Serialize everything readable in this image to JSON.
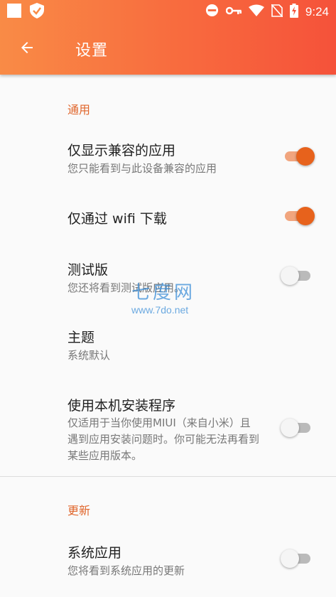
{
  "status_bar": {
    "time": "9:24",
    "icons": [
      "square-icon",
      "shield-check-icon",
      "do-not-disturb-icon",
      "key-icon",
      "wifi-icon",
      "no-sim-icon",
      "battery-charging-icon"
    ]
  },
  "app_bar": {
    "title": "设置",
    "back_icon": "arrow-left-icon",
    "gradient": [
      "#f98b46",
      "#f5523a"
    ]
  },
  "colors": {
    "accent": "#e0652b",
    "switch_on": "#e7621c"
  },
  "sections": [
    {
      "header": "通用",
      "items": [
        {
          "title": "仅显示兼容的应用",
          "subtitle": "您只能看到与此设备兼容的应用",
          "switch": true
        },
        {
          "title": "仅通过 wifi 下载",
          "switch": true
        },
        {
          "title": "测试版",
          "subtitle": "您还将看到测试版应用。",
          "switch": false
        },
        {
          "title": "主题",
          "subtitle": "系统默认"
        },
        {
          "title": "使用本机安装程序",
          "subtitle": "仅适用于当你使用MIUI（来自小米）且遇到应用安装问题时。你可能无法再看到某些应用版本。",
          "switch": false
        }
      ]
    },
    {
      "header": "更新",
      "items": [
        {
          "title": "系统应用",
          "subtitle": "您将看到系统应用的更新",
          "switch": false
        }
      ]
    }
  ],
  "watermark": {
    "logo": "七度网",
    "url": "www.7do.net"
  }
}
